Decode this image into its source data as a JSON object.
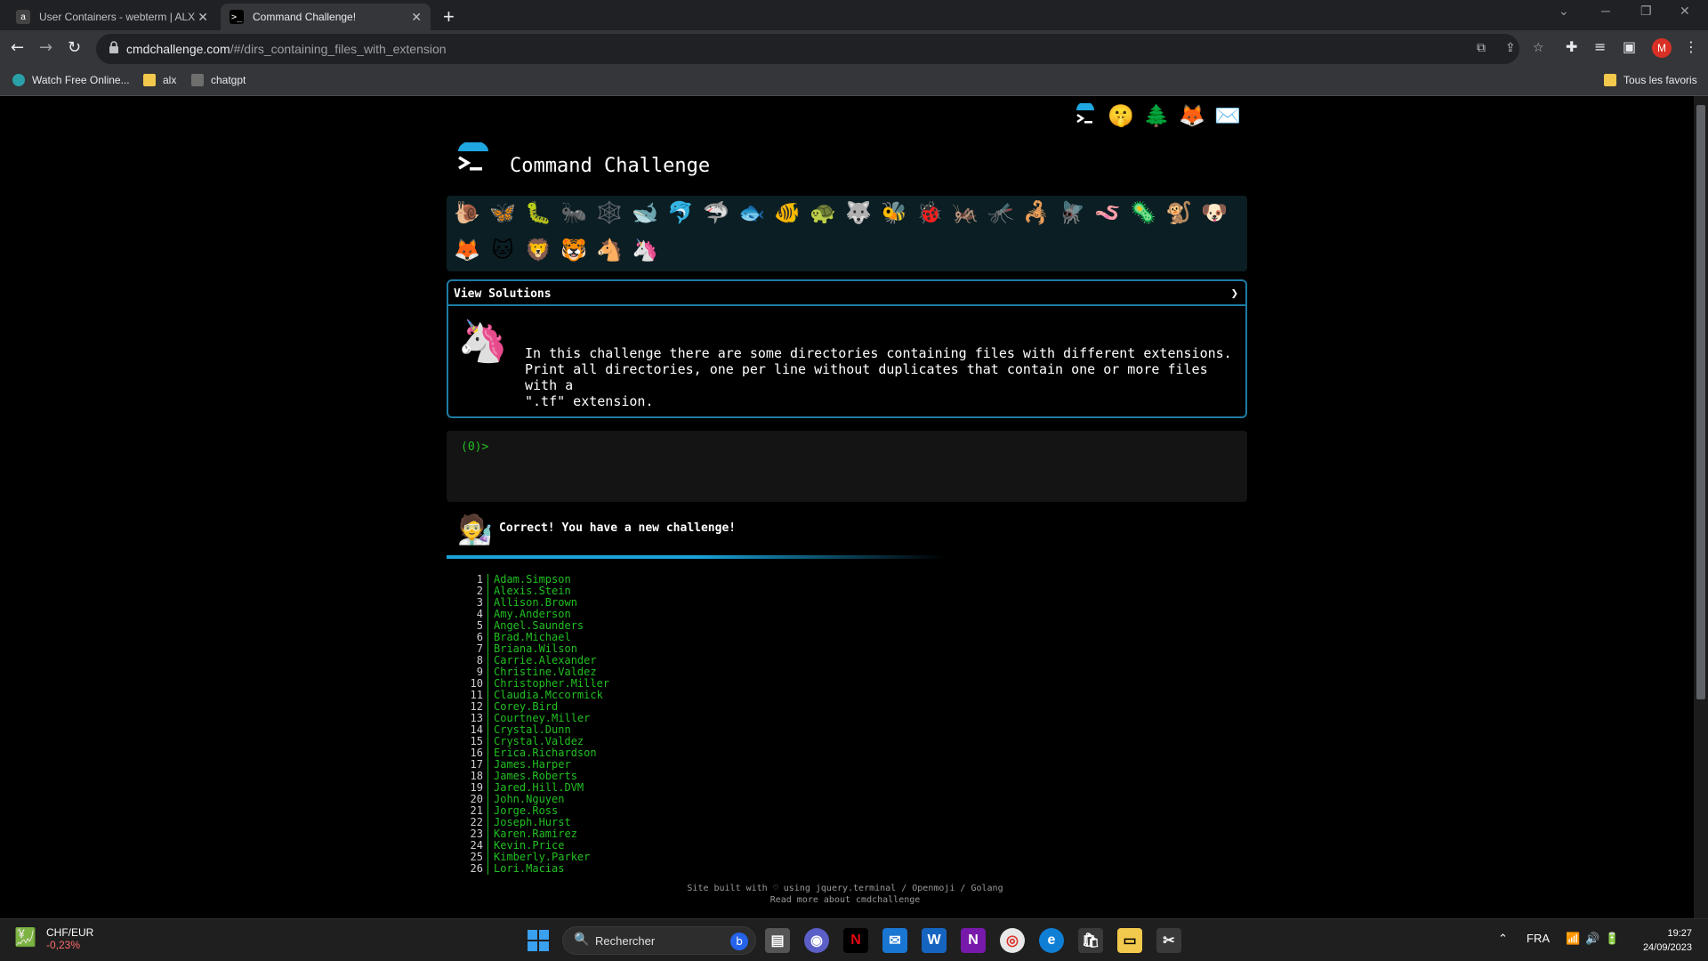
{
  "browser": {
    "tabs": [
      {
        "title": "User Containers - webterm | ALX",
        "favicon": "alx-icon"
      },
      {
        "title": "Command Challenge!",
        "favicon": "terminal-icon"
      }
    ],
    "new_tab": "+",
    "url_host": "cmdchallenge.com",
    "url_path": "/#/dirs_containing_files_with_extension",
    "avatar_letter": "M",
    "bookmarks": [
      {
        "label": "Watch Free Online..."
      },
      {
        "label": "alx"
      },
      {
        "label": "chatgpt"
      }
    ],
    "all_bookmarks": "Tous les favoris"
  },
  "site": {
    "title": "Command Challenge",
    "top_icons": [
      "terminal-icon",
      "mask-icon",
      "tree-icon",
      "gitlab-icon",
      "mail-icon"
    ],
    "levels_row1": [
      "🐌",
      "🦋",
      "🐛",
      "🐜",
      "🕸️",
      "🐋",
      "🐬",
      "🦈",
      "🐟",
      "🐠",
      "🐢",
      "🐺",
      "🐝",
      "🐞",
      "🦗",
      "🦟",
      "🦂",
      "🪰",
      "🪱",
      "🦠",
      "🐒",
      "🐶"
    ],
    "levels_row2": [
      "🦊",
      "🐱",
      "🦁",
      "🐯",
      "🐴",
      "🦄"
    ]
  },
  "challenge": {
    "header": "View Solutions",
    "chevron": "❯",
    "description_line1": "In this challenge there are some directories containing files with different extensions.",
    "description_line2": "Print all directories, one per line without duplicates that contain one or more files with a",
    "description_line3": "\".tf\" extension."
  },
  "terminal": {
    "prompt": "(0)>"
  },
  "result": {
    "message": "Correct! You have a new challenge!"
  },
  "output": [
    {
      "n": "1",
      "name": "Adam.Simpson"
    },
    {
      "n": "2",
      "name": "Alexis.Stein"
    },
    {
      "n": "3",
      "name": "Allison.Brown"
    },
    {
      "n": "4",
      "name": "Amy.Anderson"
    },
    {
      "n": "5",
      "name": "Angel.Saunders"
    },
    {
      "n": "6",
      "name": "Brad.Michael"
    },
    {
      "n": "7",
      "name": "Briana.Wilson"
    },
    {
      "n": "8",
      "name": "Carrie.Alexander"
    },
    {
      "n": "9",
      "name": "Christine.Valdez"
    },
    {
      "n": "10",
      "name": "Christopher.Miller"
    },
    {
      "n": "11",
      "name": "Claudia.Mccormick"
    },
    {
      "n": "12",
      "name": "Corey.Bird"
    },
    {
      "n": "13",
      "name": "Courtney.Miller"
    },
    {
      "n": "14",
      "name": "Crystal.Dunn"
    },
    {
      "n": "15",
      "name": "Crystal.Valdez"
    },
    {
      "n": "16",
      "name": "Erica.Richardson"
    },
    {
      "n": "17",
      "name": "James.Harper"
    },
    {
      "n": "18",
      "name": "James.Roberts"
    },
    {
      "n": "19",
      "name": "Jared.Hill.DVM"
    },
    {
      "n": "20",
      "name": "John.Nguyen"
    },
    {
      "n": "21",
      "name": "Jorge.Ross"
    },
    {
      "n": "22",
      "name": "Joseph.Hurst"
    },
    {
      "n": "23",
      "name": "Karen.Ramirez"
    },
    {
      "n": "24",
      "name": "Kevin.Price"
    },
    {
      "n": "25",
      "name": "Kimberly.Parker"
    },
    {
      "n": "26",
      "name": "Lori.Macias"
    }
  ],
  "footer": {
    "line1": "Site built with ♡ using jquery.terminal / Openmoji / Golang",
    "line2": "Read more about cmdchallenge"
  },
  "taskbar": {
    "widget_title": "CHF/EUR",
    "widget_value": "-0,23%",
    "search_placeholder": "Rechercher",
    "language": "FRA",
    "time": "19:27",
    "date": "24/09/2023"
  }
}
